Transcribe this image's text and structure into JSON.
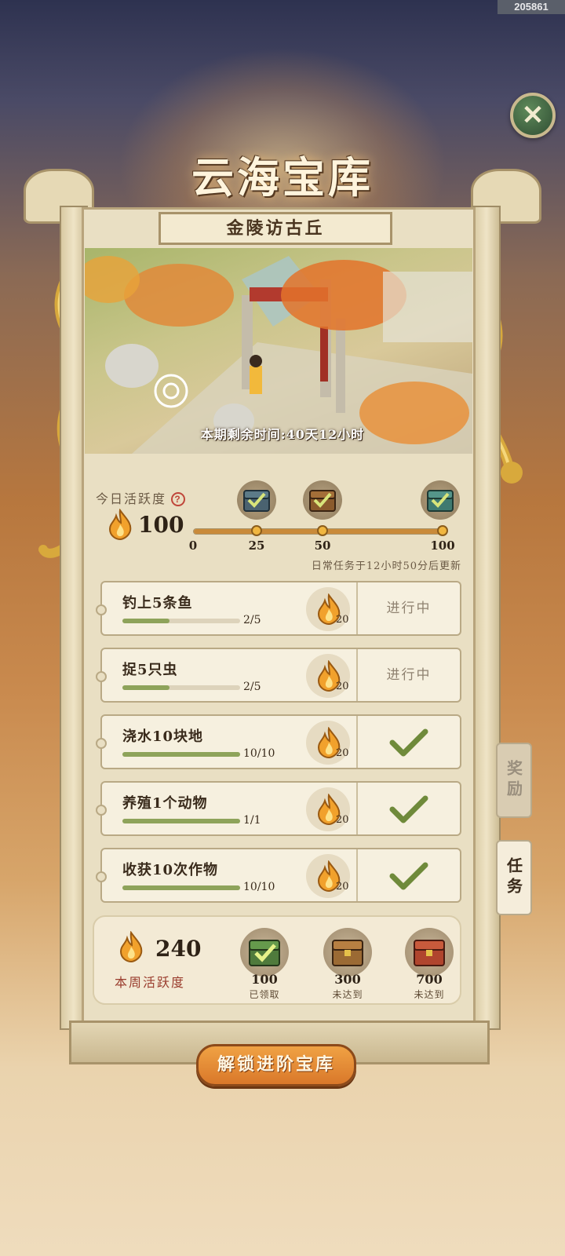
{
  "corner_id": "205861",
  "title": "云海宝库",
  "subtitle": "金陵访古丘",
  "scene": {
    "time_remaining": "本期剩余时间:40天12小时"
  },
  "daily": {
    "label": "今日活跃度",
    "help": "?",
    "value": "100",
    "progress": 1.0,
    "ticks": [
      "0",
      "25",
      "50",
      "100"
    ],
    "refresh_note": "日常任务于12小时50分后更新"
  },
  "tasks": [
    {
      "name": "钓上5条鱼",
      "count": "2/5",
      "progress": 0.4,
      "reward": "20",
      "status": "进行中",
      "done": false
    },
    {
      "name": "捉5只虫",
      "count": "2/5",
      "progress": 0.4,
      "reward": "20",
      "status": "进行中",
      "done": false
    },
    {
      "name": "浇水10块地",
      "count": "10/10",
      "progress": 1.0,
      "reward": "20",
      "status": "",
      "done": true
    },
    {
      "name": "养殖1个动物",
      "count": "1/1",
      "progress": 1.0,
      "reward": "20",
      "status": "",
      "done": true
    },
    {
      "name": "收获10次作物",
      "count": "10/10",
      "progress": 1.0,
      "reward": "20",
      "status": "",
      "done": true
    }
  ],
  "weekly": {
    "value": "240",
    "label": "本周活跃度",
    "tiers": [
      {
        "value": "100",
        "state": "已领取"
      },
      {
        "value": "300",
        "state": "未达到"
      },
      {
        "value": "700",
        "state": "未达到"
      }
    ]
  },
  "side_tabs": {
    "reward": "奖励",
    "task": "任务"
  },
  "unlock_button": "解锁进阶宝库",
  "colors": {
    "accent_orange": "#d9782a",
    "progress_green": "#8ea35a",
    "check_green": "#6f8a3a"
  }
}
